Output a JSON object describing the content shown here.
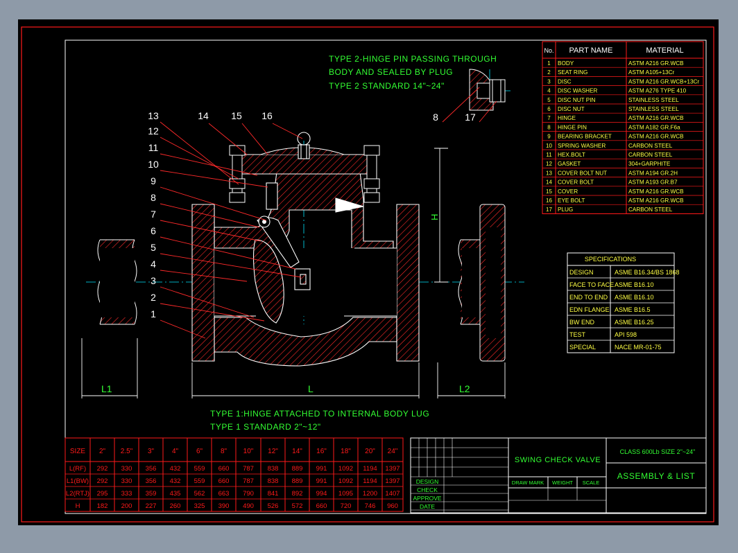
{
  "colors": {
    "frame": "#ff1a1a",
    "text_green": "#33ff33",
    "text_yellow": "#ffff44",
    "text_white": "#ffffff",
    "hatch": "#ff2a2a",
    "center": "#00e5ff",
    "body_line": "#ffffff",
    "background": "#000000",
    "canvas": "#8e9aa8"
  },
  "notes": {
    "type2_line1": "TYPE 2-HINGE PIN PASSING THROUGH",
    "type2_line2": "BODY AND SEALED BY PLUG",
    "type2_line3": "TYPE 2 STANDARD 14\"~24\"",
    "type1_line1": "TYPE 1:HINGE ATTACHED TO INTERNAL BODY LUG",
    "type1_line2": "TYPE 1 STANDARD 2\"~12\""
  },
  "dimensions": {
    "L1": "L1",
    "L": "L",
    "L2": "L2",
    "H": "H"
  },
  "balloons": [
    "1",
    "2",
    "3",
    "4",
    "5",
    "6",
    "7",
    "8",
    "9",
    "10",
    "11",
    "12",
    "13",
    "14",
    "15",
    "16"
  ],
  "detail_balloons": [
    "8",
    "17"
  ],
  "parts_list": {
    "headers": [
      "No.",
      "PART NAME",
      "MATERIAL"
    ],
    "rows": [
      [
        "1",
        "BODY",
        "ASTM A216 GR.WCB"
      ],
      [
        "2",
        "SEAT RING",
        "ASTM A105+13Cr"
      ],
      [
        "3",
        "DISC",
        "ASTM A216 GR.WCB+13Cr"
      ],
      [
        "4",
        "DISC WASHER",
        "ASTM A276 TYPE 410"
      ],
      [
        "5",
        "DISC NUT PIN",
        "STAINLESS STEEL"
      ],
      [
        "6",
        "DISC NUT",
        "STAINLESS STEEL"
      ],
      [
        "7",
        "HINGE",
        "ASTM A216 GR.WCB"
      ],
      [
        "8",
        "HINGE PIN",
        "ASTM A182 GR.F6a"
      ],
      [
        "9",
        "BEARING BRACKET",
        "ASTM A216 GR.WCB"
      ],
      [
        "10",
        "SPRING WASHER",
        "CARBON STEEL"
      ],
      [
        "11",
        "HEX.BOLT",
        "CARBON STEEL"
      ],
      [
        "12",
        "GASKET",
        "304+GARPHITE"
      ],
      [
        "13",
        "COVER BOLT NUT",
        "ASTM A194 GR.2H"
      ],
      [
        "14",
        "COVER BOLT",
        "ASTM A193 GR.B7"
      ],
      [
        "15",
        "COVER",
        "ASTM A216 GR.WCB"
      ],
      [
        "16",
        "EYE BOLT",
        "ASTM A216 GR.WCB"
      ],
      [
        "17",
        "PLUG",
        "CARBON STEEL"
      ]
    ]
  },
  "specifications": {
    "title": "SPECIFICATIONS",
    "rows": [
      [
        "DESIGN",
        "ASME B16.34/BS 1868"
      ],
      [
        "FACE TO FACE",
        "ASME B16.10"
      ],
      [
        "END TO END",
        "ASME B16.10"
      ],
      [
        "EDN FLANGE",
        "ASME B16.5"
      ],
      [
        "BW END",
        "ASME B16.25"
      ],
      [
        "TEST",
        "API 598"
      ],
      [
        "SPECIAL",
        "NACE MR-01-75"
      ]
    ]
  },
  "size_table": {
    "headers": [
      "SIZE",
      "2\"",
      "2.5\"",
      "3\"",
      "4\"",
      "6\"",
      "8\"",
      "10\"",
      "12\"",
      "14\"",
      "16\"",
      "18\"",
      "20\"",
      "24\""
    ],
    "rows": [
      [
        "L(RF)",
        "292",
        "330",
        "356",
        "432",
        "559",
        "660",
        "787",
        "838",
        "889",
        "991",
        "1092",
        "1194",
        "1397"
      ],
      [
        "L1(BW)",
        "292",
        "330",
        "356",
        "432",
        "559",
        "660",
        "787",
        "838",
        "889",
        "991",
        "1092",
        "1194",
        "1397"
      ],
      [
        "L2(RTJ)",
        "295",
        "333",
        "359",
        "435",
        "562",
        "663",
        "790",
        "841",
        "892",
        "994",
        "1095",
        "1200",
        "1407"
      ],
      [
        "H",
        "182",
        "200",
        "227",
        "260",
        "325",
        "390",
        "490",
        "526",
        "572",
        "660",
        "720",
        "746",
        "960"
      ]
    ]
  },
  "title_block": {
    "approval": [
      "DESIGN",
      "CHECK",
      "APPROVE",
      "DATE"
    ],
    "drawing_name": "SWING CHECK VALVE",
    "class_size": "CLASS 600Lb SIZE 2\"~24\"",
    "title": "ASSEMBLY & LIST",
    "draw_mark": "DRAW MARK",
    "weight": "WEIGHT",
    "scale": "SCALE"
  }
}
